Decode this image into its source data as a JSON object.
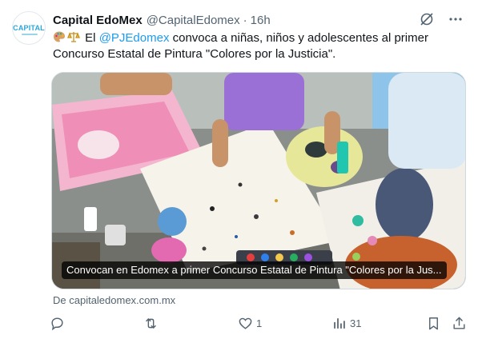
{
  "tweet": {
    "author": {
      "display_name": "Capital EdoMex",
      "handle": "@CapitalEdomex",
      "avatar_text": "CAPITAL"
    },
    "time": "16h",
    "dot": "·",
    "text_before_mention": "El ",
    "mention": "@PJEdomex",
    "text_after_mention": " convoca a niñas, niños y adolescentes al primer Concurso Estatal de Pintura \"Colores por la Justicia\".",
    "emojis": [
      "artist-palette-icon",
      "scales-icon"
    ],
    "card": {
      "title": "Convocan en Edomex a primer Concurso Estatal de Pintura \"Colores por la Jus...",
      "image": "children-painting-on-paper-at-table"
    },
    "source": "De capitaledomex.com.mx",
    "actions": {
      "reply": {
        "icon": "reply-icon",
        "count": ""
      },
      "retweet": {
        "icon": "retweet-icon",
        "count": ""
      },
      "like": {
        "icon": "heart-icon",
        "count": "1"
      },
      "views": {
        "icon": "views-icon",
        "count": "31"
      },
      "bookmark": {
        "icon": "bookmark-icon"
      },
      "share": {
        "icon": "share-icon"
      }
    }
  },
  "colors": {
    "accent": "#1d9bf0",
    "text": "#0f1419",
    "muted": "#536471"
  }
}
